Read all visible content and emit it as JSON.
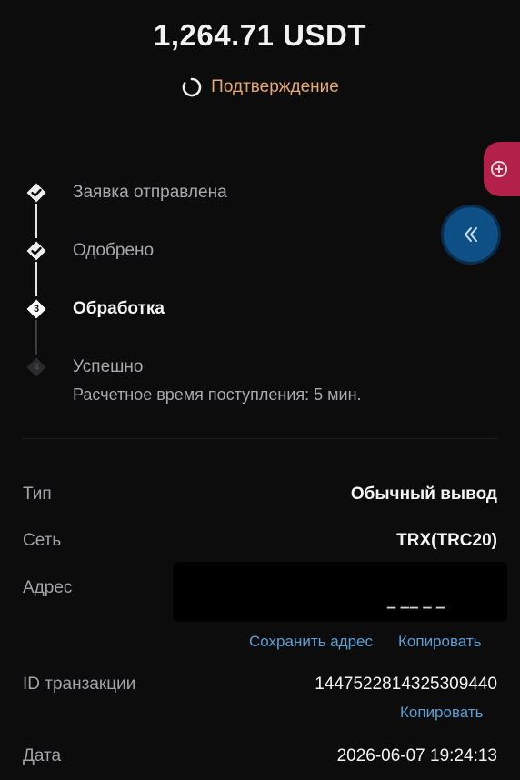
{
  "header": {
    "amount": "1,264.71 USDT",
    "status": "Подтверждение",
    "status_color": "#e8a96d"
  },
  "steps": [
    {
      "label": "Заявка отправлена",
      "state": "done"
    },
    {
      "label": "Одобрено",
      "state": "done"
    },
    {
      "number": "3",
      "label": "Обработка",
      "state": "active"
    },
    {
      "number": "4",
      "label": "Успешно",
      "state": "pending",
      "sub": "Расчетное время поступления: 5 мин."
    }
  ],
  "details": {
    "type_label": "Тип",
    "type_value": "Обычный вывод",
    "network_label": "Сеть",
    "network_value": "TRX(TRC20)",
    "address_label": "Адрес",
    "save_address": "Сохранить адрес",
    "copy_address": "Копировать",
    "txid_label": "ID транзакции",
    "txid_value": "1447522814325309440",
    "copy_txid": "Копировать",
    "date_label": "Дата",
    "date_value": "2026-06-07 19:24:13"
  },
  "icons": {
    "side": "add-circle-icon",
    "collapse": "double-chevron-left-icon"
  },
  "colors": {
    "background": "#0c0c0d",
    "link": "#5aa0d6",
    "pill": "#b3204a",
    "fab": "#0e4f86"
  }
}
